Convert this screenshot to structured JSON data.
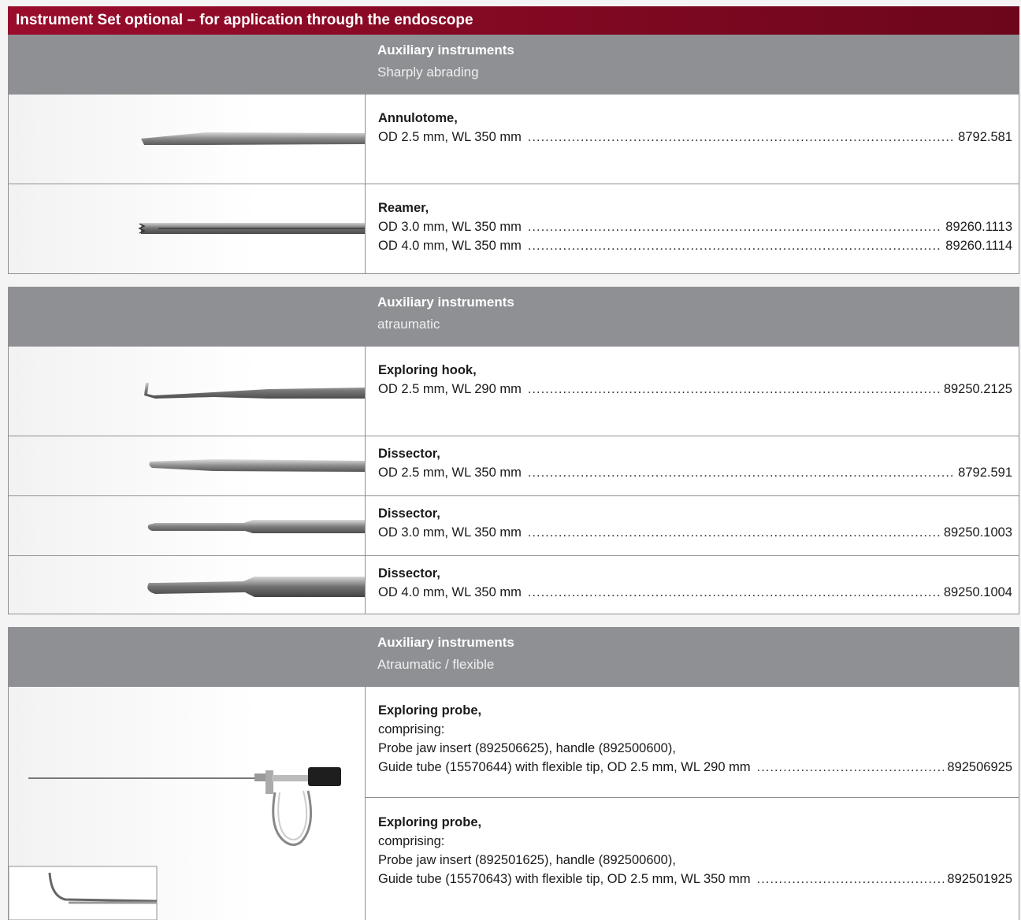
{
  "header": {
    "title": "Instrument Set optional – for application through the endoscope"
  },
  "sections": [
    {
      "title": "Auxiliary instruments",
      "subtitle": "Sharply abrading",
      "items": [
        {
          "name": "Annulotome,",
          "lines": [
            {
              "spec": "OD 2.5 mm, WL 350 mm",
              "code": "8792.581"
            }
          ]
        },
        {
          "name": "Reamer,",
          "lines": [
            {
              "spec": "OD 3.0 mm, WL 350 mm",
              "code": "89260.1113"
            },
            {
              "spec": "OD 4.0 mm, WL 350 mm",
              "code": "89260.1114"
            }
          ]
        }
      ]
    },
    {
      "title": "Auxiliary instruments",
      "subtitle": "atraumatic",
      "items": [
        {
          "name": "Exploring hook,",
          "lines": [
            {
              "spec": "OD 2.5 mm, WL 290 mm",
              "code": "89250.2125"
            }
          ]
        },
        {
          "name": "Dissector,",
          "lines": [
            {
              "spec": "OD 2.5 mm, WL 350 mm",
              "code": "8792.591"
            }
          ]
        },
        {
          "name": "Dissector,",
          "lines": [
            {
              "spec": "OD 3.0 mm, WL 350 mm",
              "code": "89250.1003"
            }
          ]
        },
        {
          "name": "Dissector,",
          "lines": [
            {
              "spec": "OD 4.0 mm, WL 350 mm",
              "code": "89250.1004"
            }
          ]
        }
      ]
    },
    {
      "title": "Auxiliary instruments",
      "subtitle": "Atraumatic / flexible",
      "items": [
        {
          "name": "Exploring probe,",
          "comprising": "comprising:",
          "parts": "Probe jaw insert (892506625), handle (892500600),",
          "lines": [
            {
              "spec": "Guide tube (15570644) with flexible tip, OD 2.5 mm, WL 290 mm",
              "code": "892506925"
            }
          ]
        },
        {
          "name": "Exploring probe,",
          "comprising": "comprising:",
          "parts": "Probe jaw insert (892501625), handle (892500600),",
          "lines": [
            {
              "spec": "Guide tube (15570643) with flexible tip, OD 2.5 mm, WL 350 mm",
              "code": "892501925"
            }
          ]
        }
      ]
    }
  ]
}
